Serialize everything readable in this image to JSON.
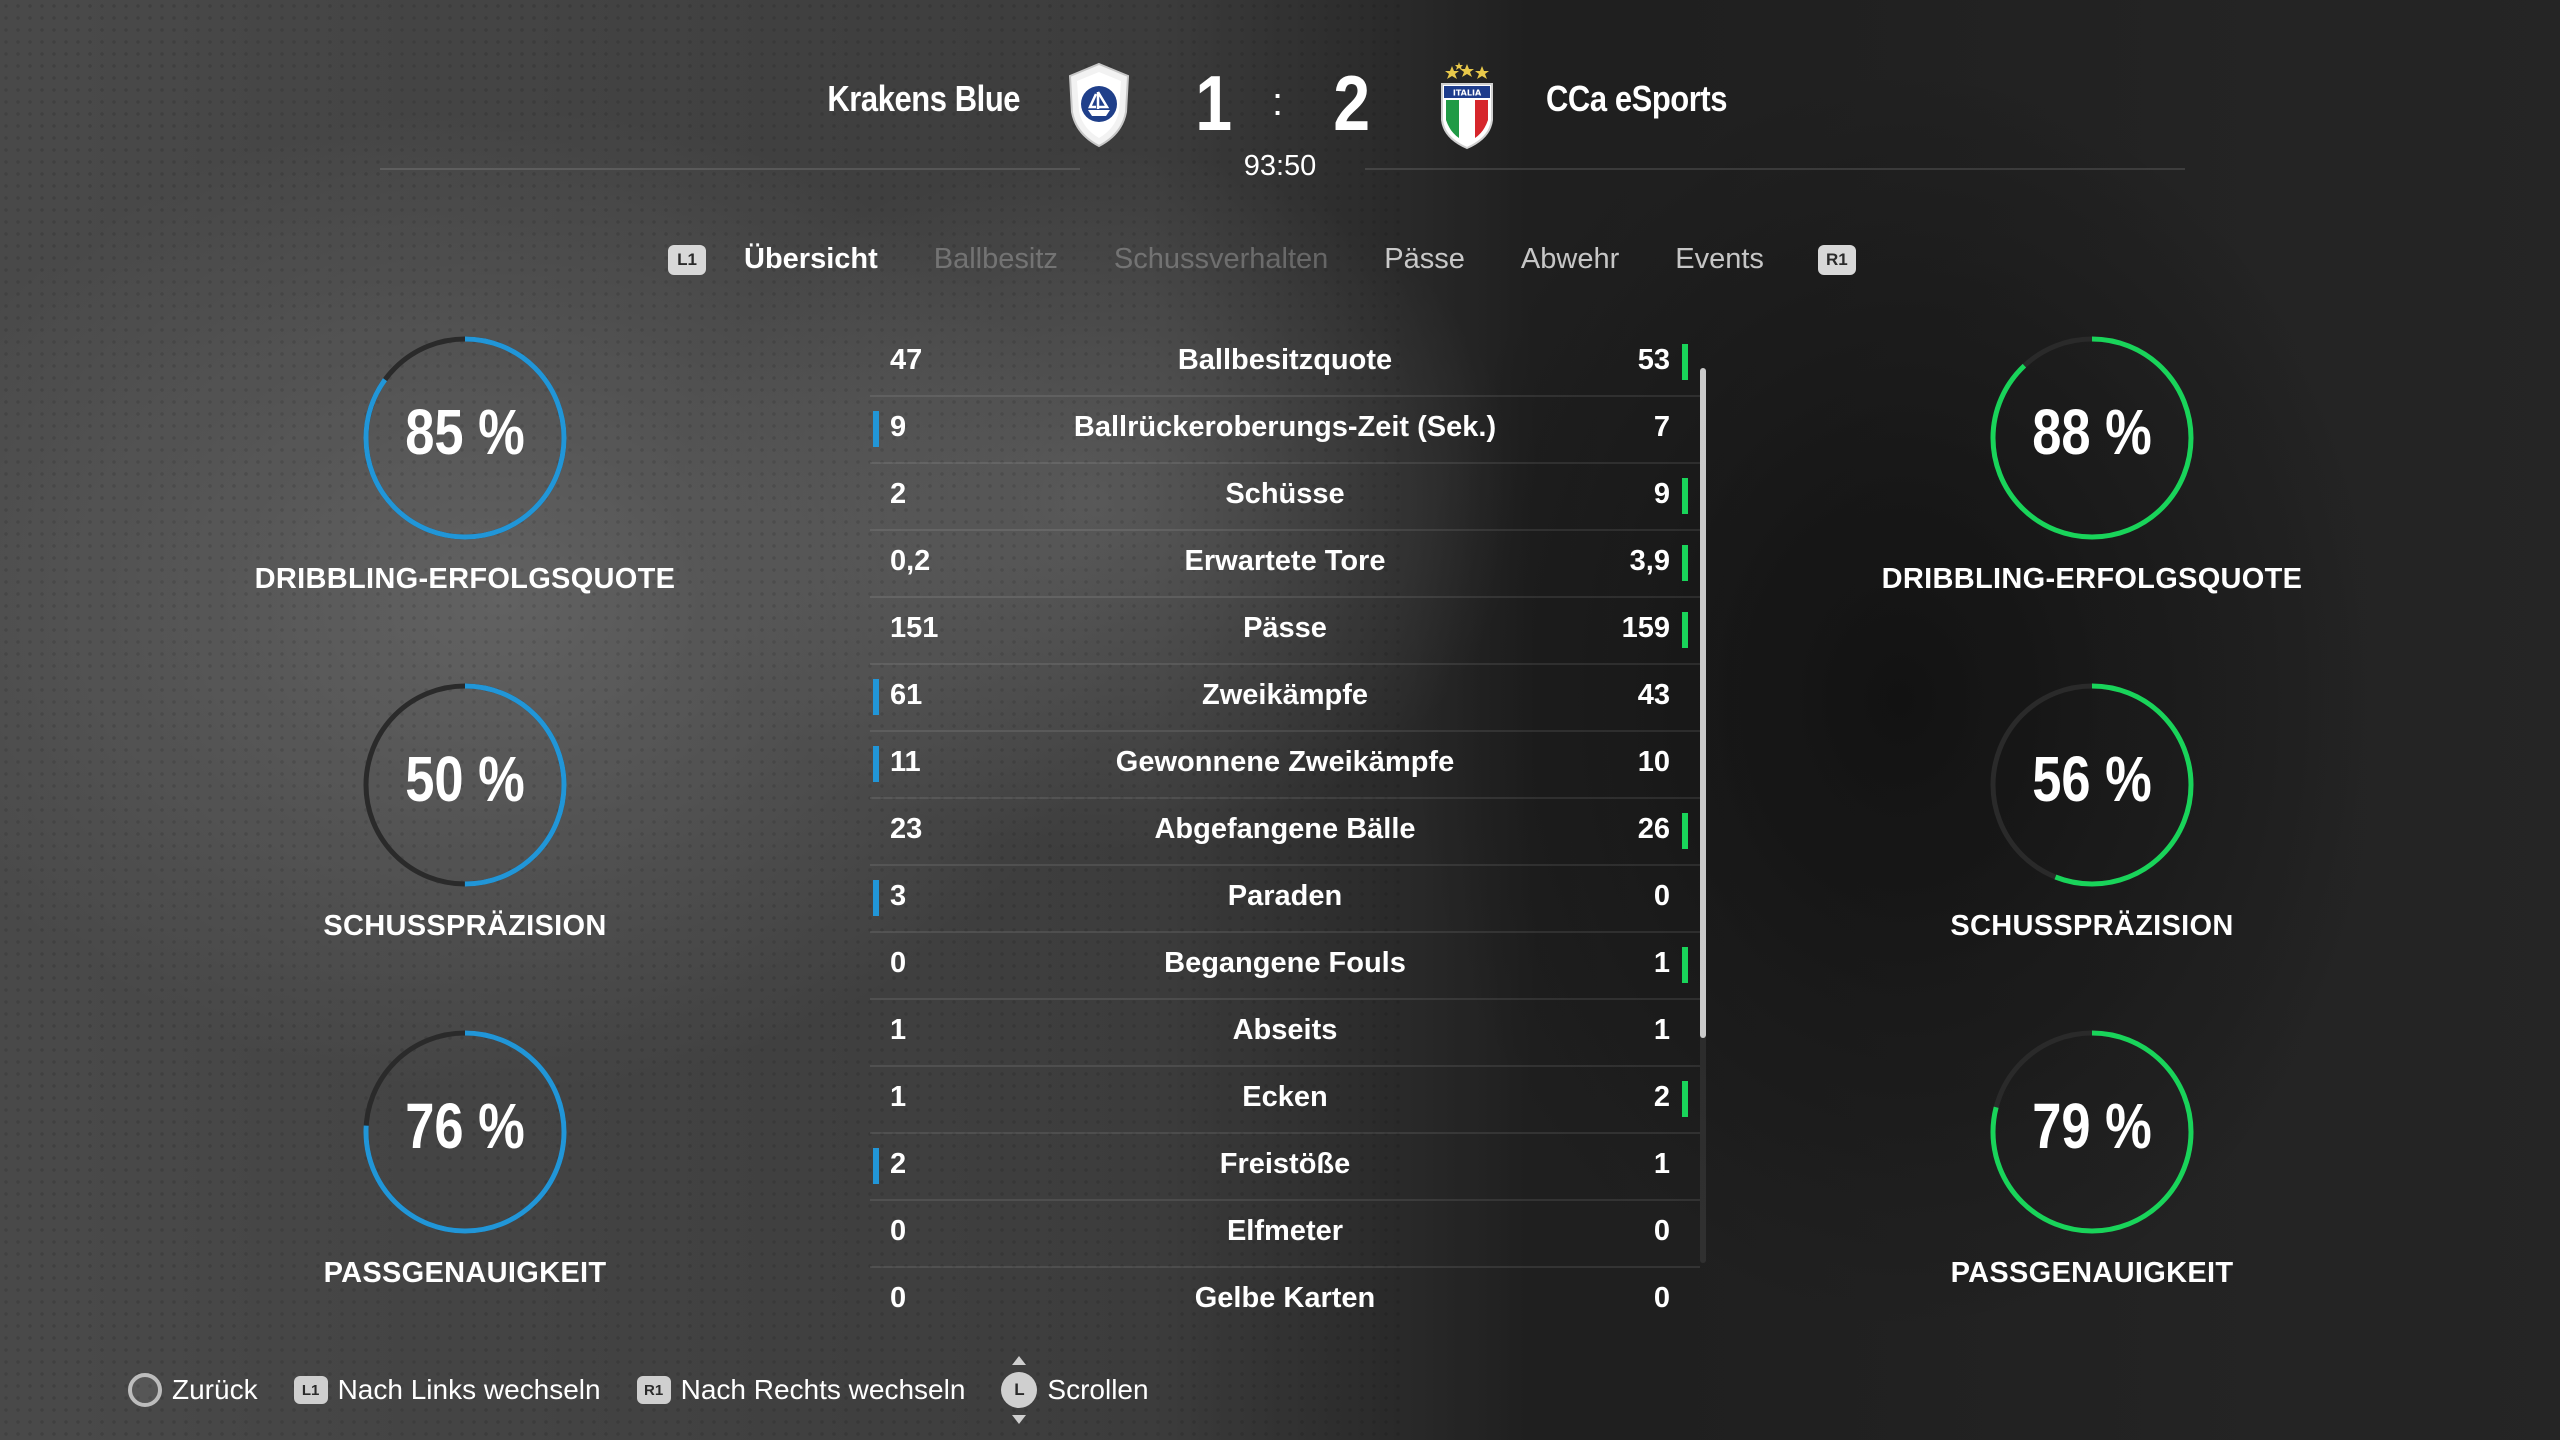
{
  "header": {
    "home_team": "Krakens Blue",
    "away_team": "CCa eSports",
    "home_score": "1",
    "away_score": "2",
    "separator": ":",
    "match_time": "93:50",
    "away_crest_text": "ITALIA"
  },
  "tabs": {
    "left_bumper": "L1",
    "right_bumper": "R1",
    "items": [
      {
        "label": "Übersicht",
        "state": "active"
      },
      {
        "label": "Ballbesitz",
        "state": "disabled"
      },
      {
        "label": "Schussverhalten",
        "state": "disabled"
      },
      {
        "label": "Pässe",
        "state": "normal"
      },
      {
        "label": "Abwehr",
        "state": "normal"
      },
      {
        "label": "Events",
        "state": "normal"
      }
    ]
  },
  "rings": {
    "home": [
      {
        "value": "85 %",
        "label": "DRIBBLING-ERFOLGSQUOTE",
        "fraction": 0.85
      },
      {
        "value": "50 %",
        "label": "SCHUSSPRÄZISION",
        "fraction": 0.5
      },
      {
        "value": "76 %",
        "label": "PASSGENAUIGKEIT",
        "fraction": 0.76
      }
    ],
    "away": [
      {
        "value": "88 %",
        "label": "DRIBBLING-ERFOLGSQUOTE",
        "fraction": 0.88
      },
      {
        "value": "56 %",
        "label": "SCHUSSPRÄZISION",
        "fraction": 0.56
      },
      {
        "value": "79 %",
        "label": "PASSGENAUIGKEIT",
        "fraction": 0.79
      }
    ],
    "home_color": "#2196d8",
    "away_color": "#19d45a",
    "track_color": "#2a2a2a"
  },
  "stats": [
    {
      "name": "Ballbesitzquote",
      "home": "47",
      "away": "53",
      "lead": "away"
    },
    {
      "name": "Ballrückeroberungs-Zeit (Sek.)",
      "home": "9",
      "away": "7",
      "lead": "home"
    },
    {
      "name": "Schüsse",
      "home": "2",
      "away": "9",
      "lead": "away"
    },
    {
      "name": "Erwartete Tore",
      "home": "0,2",
      "away": "3,9",
      "lead": "away"
    },
    {
      "name": "Pässe",
      "home": "151",
      "away": "159",
      "lead": "away"
    },
    {
      "name": "Zweikämpfe",
      "home": "61",
      "away": "43",
      "lead": "home"
    },
    {
      "name": "Gewonnene Zweikämpfe",
      "home": "11",
      "away": "10",
      "lead": "home"
    },
    {
      "name": "Abgefangene Bälle",
      "home": "23",
      "away": "26",
      "lead": "away"
    },
    {
      "name": "Paraden",
      "home": "3",
      "away": "0",
      "lead": "home"
    },
    {
      "name": "Begangene Fouls",
      "home": "0",
      "away": "1",
      "lead": "away"
    },
    {
      "name": "Abseits",
      "home": "1",
      "away": "1",
      "lead": "none"
    },
    {
      "name": "Ecken",
      "home": "1",
      "away": "2",
      "lead": "away"
    },
    {
      "name": "Freistöße",
      "home": "2",
      "away": "1",
      "lead": "home"
    },
    {
      "name": "Elfmeter",
      "home": "0",
      "away": "0",
      "lead": "none"
    },
    {
      "name": "Gelbe Karten",
      "home": "0",
      "away": "0",
      "lead": "none"
    }
  ],
  "footer": {
    "back": "Zurück",
    "l1_badge": "L1",
    "switch_left": "Nach Links wechseln",
    "r1_badge": "R1",
    "switch_right": "Nach Rechts wechseln",
    "stick_badge": "L",
    "scroll": "Scrollen"
  }
}
